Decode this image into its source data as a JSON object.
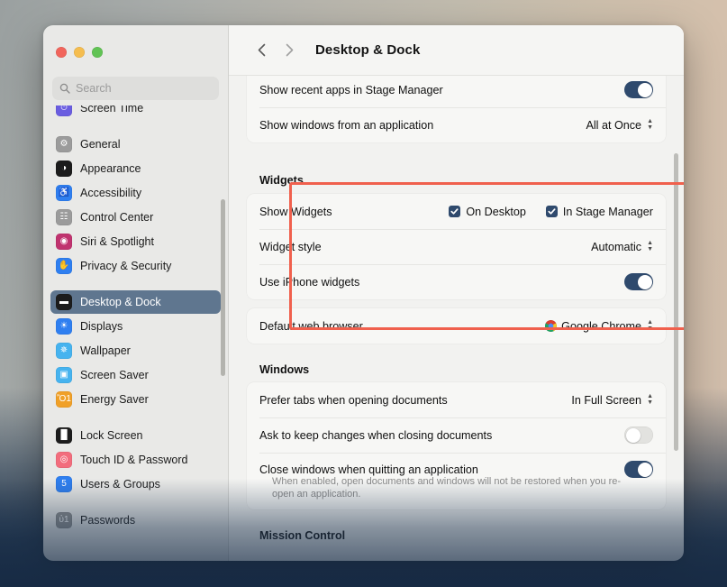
{
  "window": {
    "title": "Desktop & Dock",
    "traffic_lights": [
      "close",
      "minimize",
      "zoom"
    ]
  },
  "sidebar": {
    "search": {
      "placeholder": "Search",
      "value": ""
    },
    "items": [
      {
        "label": "Screen Time",
        "icon": "screen-time-icon",
        "color": "#6a5de0",
        "glyph": "⏱",
        "selected": false,
        "clipped": true
      },
      {
        "gap": true
      },
      {
        "label": "General",
        "icon": "general-icon",
        "color": "#9b9b9b",
        "glyph": "⚙",
        "selected": false
      },
      {
        "label": "Appearance",
        "icon": "appearance-icon",
        "color": "#1c1c1c",
        "glyph": "◑",
        "selected": false
      },
      {
        "label": "Accessibility",
        "icon": "accessibility-icon",
        "color": "#2f7ff0",
        "glyph": "♿",
        "selected": false
      },
      {
        "label": "Control Center",
        "icon": "control-center-icon",
        "color": "#9b9b9b",
        "glyph": "☷",
        "selected": false
      },
      {
        "label": "Siri & Spotlight",
        "icon": "siri-icon",
        "color": "#c0336f",
        "glyph": "◉",
        "selected": false
      },
      {
        "label": "Privacy & Security",
        "icon": "privacy-icon",
        "color": "#2f7ff0",
        "glyph": "✋",
        "selected": false
      },
      {
        "gap": true
      },
      {
        "label": "Desktop & Dock",
        "icon": "desktop-dock-icon",
        "color": "#1c1c1c",
        "glyph": "▬",
        "selected": true
      },
      {
        "label": "Displays",
        "icon": "displays-icon",
        "color": "#2f7ff0",
        "glyph": "☀",
        "selected": false
      },
      {
        "label": "Wallpaper",
        "icon": "wallpaper-icon",
        "color": "#46b3ef",
        "glyph": "✵",
        "selected": false
      },
      {
        "label": "Screen Saver",
        "icon": "screen-saver-icon",
        "color": "#46b3ef",
        "glyph": "▣",
        "selected": false
      },
      {
        "label": "Energy Saver",
        "icon": "energy-saver-icon",
        "color": "#f0a028",
        "glyph": "Ὂ1",
        "selected": false
      },
      {
        "gap": true
      },
      {
        "label": "Lock Screen",
        "icon": "lock-screen-icon",
        "color": "#1c1c1c",
        "glyph": "█",
        "selected": false
      },
      {
        "label": "Touch ID & Password",
        "icon": "touch-id-icon",
        "color": "#f26d7d",
        "glyph": "◎",
        "selected": false
      },
      {
        "label": "Users & Groups",
        "icon": "users-groups-icon",
        "color": "#2f7ff0",
        "glyph": "὆5",
        "selected": false
      },
      {
        "gap": true
      },
      {
        "label": "Passwords",
        "icon": "passwords-icon",
        "color": "#8e8e8e",
        "glyph": "ὑ1",
        "selected": false
      }
    ]
  },
  "main": {
    "top_card": {
      "rows": [
        {
          "name": "show-recent-apps-stage-manager",
          "label": "Show recent apps in Stage Manager",
          "control": "toggle",
          "value": true
        },
        {
          "name": "show-windows-from-application",
          "label": "Show windows from an application",
          "control": "popup",
          "value": "All at Once"
        }
      ]
    },
    "widgets_section": {
      "heading": "Widgets",
      "highlighted": true,
      "highlight_color": "#f0604d",
      "rows": [
        {
          "name": "show-widgets",
          "label": "Show Widgets",
          "control": "checkboxes",
          "checkboxes": [
            {
              "label": "On Desktop",
              "checked": true
            },
            {
              "label": "In Stage Manager",
              "checked": true
            }
          ]
        },
        {
          "name": "widget-style",
          "label": "Widget style",
          "control": "popup",
          "value": "Automatic"
        },
        {
          "name": "use-iphone-widgets",
          "label": "Use iPhone widgets",
          "control": "toggle",
          "value": true
        }
      ]
    },
    "browser_card": {
      "rows": [
        {
          "name": "default-web-browser",
          "label": "Default web browser",
          "control": "popup",
          "value": "Google Chrome",
          "icon": "chrome-icon"
        }
      ]
    },
    "windows_section": {
      "heading": "Windows",
      "rows": [
        {
          "name": "prefer-tabs-opening-documents",
          "label": "Prefer tabs when opening documents",
          "control": "popup",
          "value": "In Full Screen"
        },
        {
          "name": "ask-keep-changes-closing-documents",
          "label": "Ask to keep changes when closing documents",
          "control": "toggle",
          "value": false
        },
        {
          "name": "close-windows-quitting-application",
          "label": "Close windows when quitting an application",
          "control": "toggle",
          "value": true,
          "caption": "When enabled, open documents and windows will not be restored when you re-open an application."
        }
      ]
    },
    "mission_control_section": {
      "heading": "Mission Control"
    }
  },
  "colors": {
    "accent": "#2f4a6d",
    "highlight": "#f0604d",
    "selected_row": "#5f768f"
  }
}
